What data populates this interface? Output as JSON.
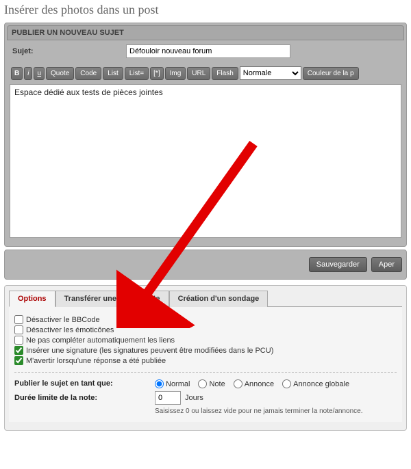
{
  "page_title": "Insérer des photos dans un post",
  "panel_header": "PUBLIER UN NOUVEAU SUJET",
  "subject": {
    "label": "Sujet:",
    "value": "Défouloir nouveau forum"
  },
  "toolbar": {
    "bold": "B",
    "italic": "i",
    "underline": "u",
    "quote": "Quote",
    "code": "Code",
    "list": "List",
    "list_eq": "List=",
    "item": "[*]",
    "img": "Img",
    "url": "URL",
    "flash": "Flash",
    "size_selected": "Normale",
    "color": "Couleur de la p"
  },
  "editor_value": "Espace dédié aux tests de pièces jointes",
  "actions": {
    "save": "Sauvegarder",
    "preview": "Aper"
  },
  "tabs": {
    "options": "Options",
    "transfer": "Transférer une pièce jointe",
    "poll": "Création d'un sondage"
  },
  "options": {
    "disable_bbcode": "Désactiver le BBCode",
    "disable_emoticons": "Désactiver les émoticônes",
    "no_autolink": "Ne pas compléter automatiquement les liens",
    "signature": "Insérer une signature (les signatures peuvent être modifiées dans le PCU)",
    "notify": "M'avertir lorsqu'une réponse a été publiée"
  },
  "publish_as": {
    "label": "Publier le sujet en tant que:",
    "normal": "Normal",
    "note": "Note",
    "annonce": "Annonce",
    "annonce_globale": "Annonce globale"
  },
  "duration": {
    "label": "Durée limite de la note:",
    "value": "0",
    "unit": "Jours",
    "hint": "Saisissez 0 ou laissez vide pour ne jamais terminer la note/annonce."
  }
}
